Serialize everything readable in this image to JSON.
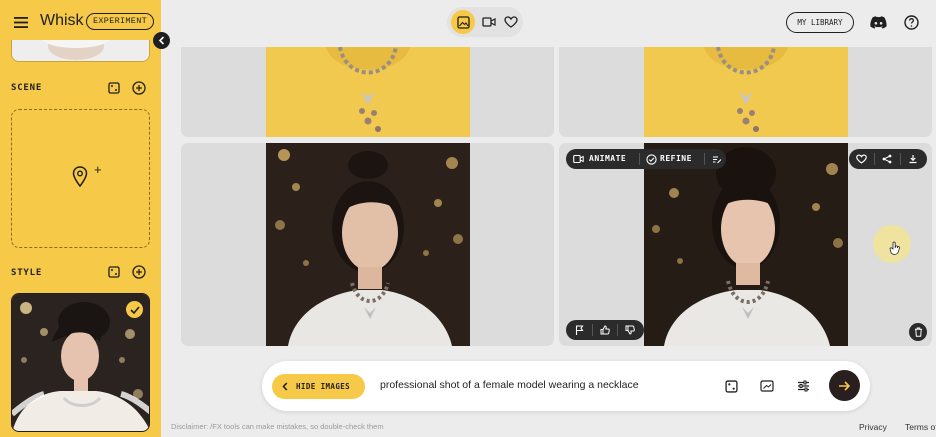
{
  "app": {
    "title": "Whisk",
    "badge": "EXPERIMENT"
  },
  "header": {
    "my_library": "MY LIBRARY"
  },
  "sidebar": {
    "scene_label": "SCENE",
    "style_label": "STYLE"
  },
  "result_card": {
    "animate_label": "ANIMATE",
    "refine_label": "REFINE"
  },
  "prompt_bar": {
    "hide_images_label": "HIDE IMAGES",
    "prompt_text": "professional shot of a female model wearing a necklace"
  },
  "footer": {
    "disclaimer": "Disclaimer: /FX tools can make mistakes, so double-check them",
    "privacy": "Privacy",
    "terms": "Terms of"
  },
  "colors": {
    "accent_yellow": "#f7c948",
    "dark": "#2b2b2b",
    "background": "#ececec"
  }
}
